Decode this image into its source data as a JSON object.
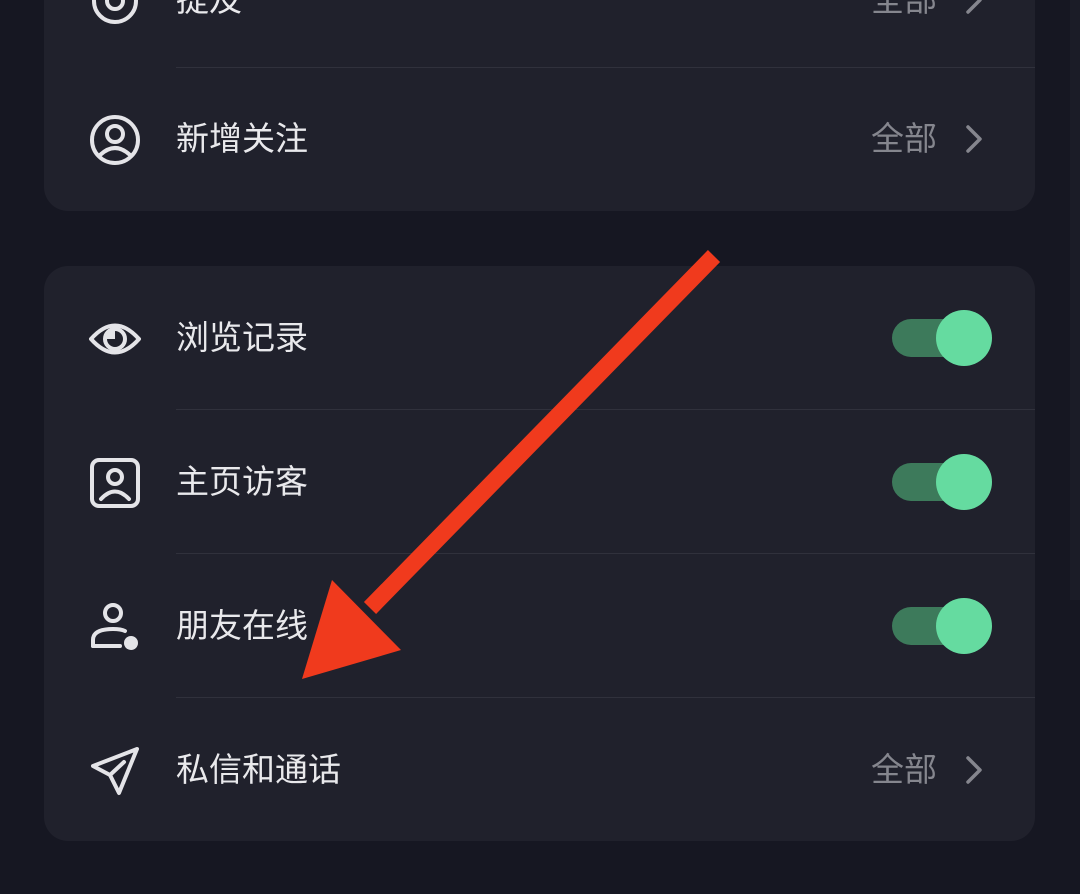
{
  "sections": [
    {
      "rows": [
        {
          "label": "提及",
          "value": "全部",
          "icon": "at-icon",
          "control": "chevron"
        },
        {
          "label": "新增关注",
          "value": "全部",
          "icon": "user-circle-icon",
          "control": "chevron"
        }
      ]
    },
    {
      "rows": [
        {
          "label": "浏览记录",
          "icon": "eye-icon",
          "control": "toggle",
          "checked": true
        },
        {
          "label": "主页访客",
          "icon": "profile-card-icon",
          "control": "toggle",
          "checked": true
        },
        {
          "label": "朋友在线",
          "icon": "user-online-icon",
          "control": "toggle",
          "checked": true
        },
        {
          "label": "私信和通话",
          "value": "全部",
          "icon": "paper-plane-icon",
          "control": "chevron"
        }
      ]
    }
  ],
  "colors": {
    "background": "#161722",
    "card": "#20212c",
    "toggle_on_track": "#3d7a5b",
    "toggle_on_knob": "#65dba0",
    "annotation_arrow": "#f03a1d"
  }
}
